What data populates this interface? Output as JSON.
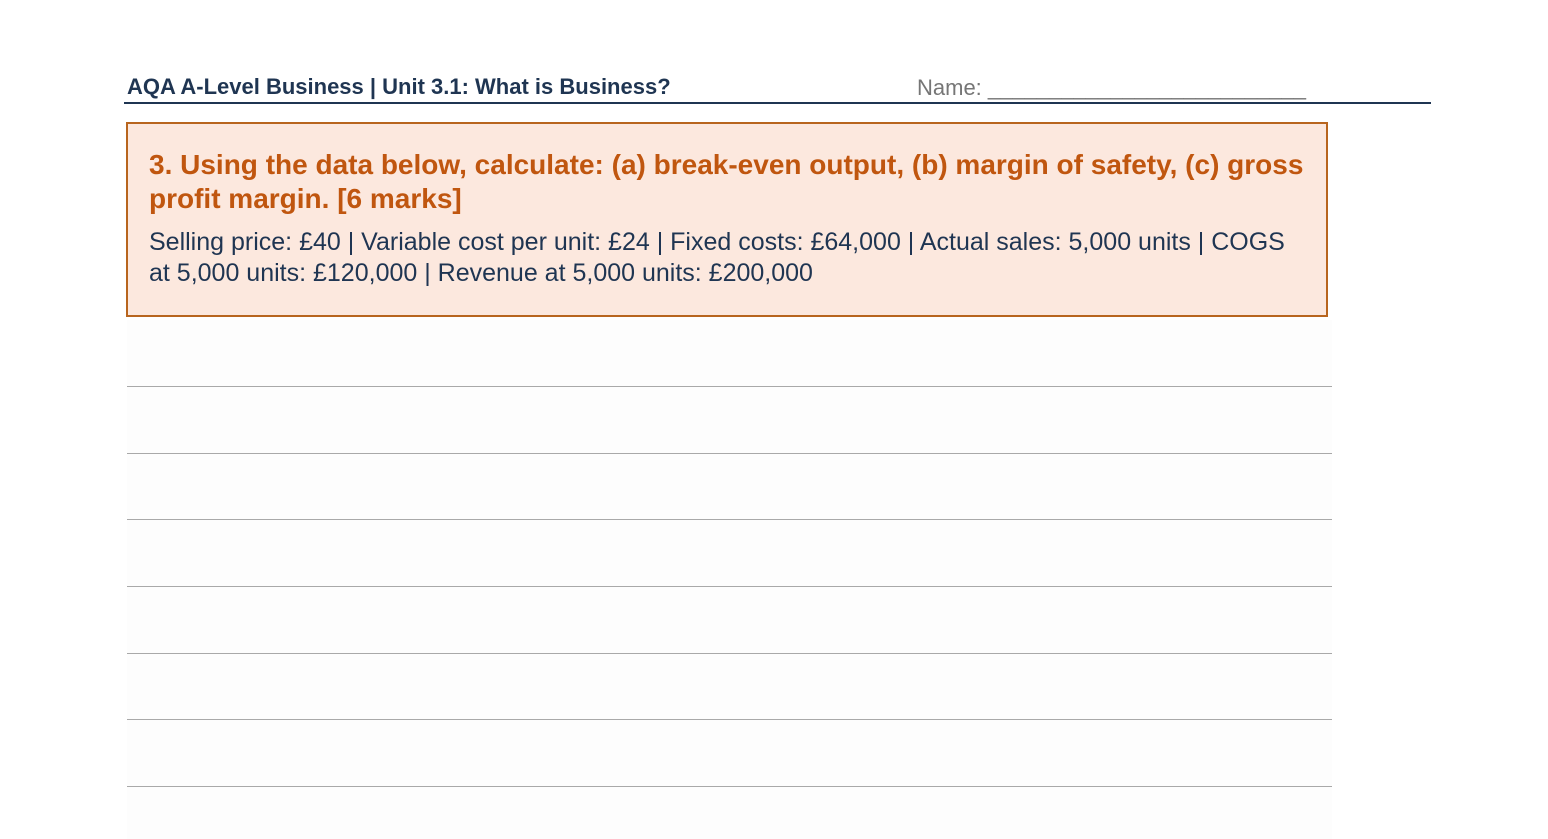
{
  "header": {
    "title": "AQA A-Level Business | Unit 3.1: What is Business?",
    "name_label": "Name: __________________________"
  },
  "question": {
    "title": "3. Using the data below, calculate: (a) break-even output, (b) margin of safety, (c) gross profit margin. [6 marks]",
    "data": "Selling price: £40 | Variable cost per unit: £24 | Fixed costs: £64,000 | Actual sales: 5,000 units | COGS at 5,000 units: £120,000 | Revenue at 5,000 units: £200,000"
  },
  "answer_area": {
    "line_count": 7
  },
  "colors": {
    "header_text": "#1f3552",
    "question_title": "#c0560f",
    "question_box_bg": "#fce8de",
    "question_box_border": "#b8651e",
    "answer_line": "#a9a9a9"
  }
}
